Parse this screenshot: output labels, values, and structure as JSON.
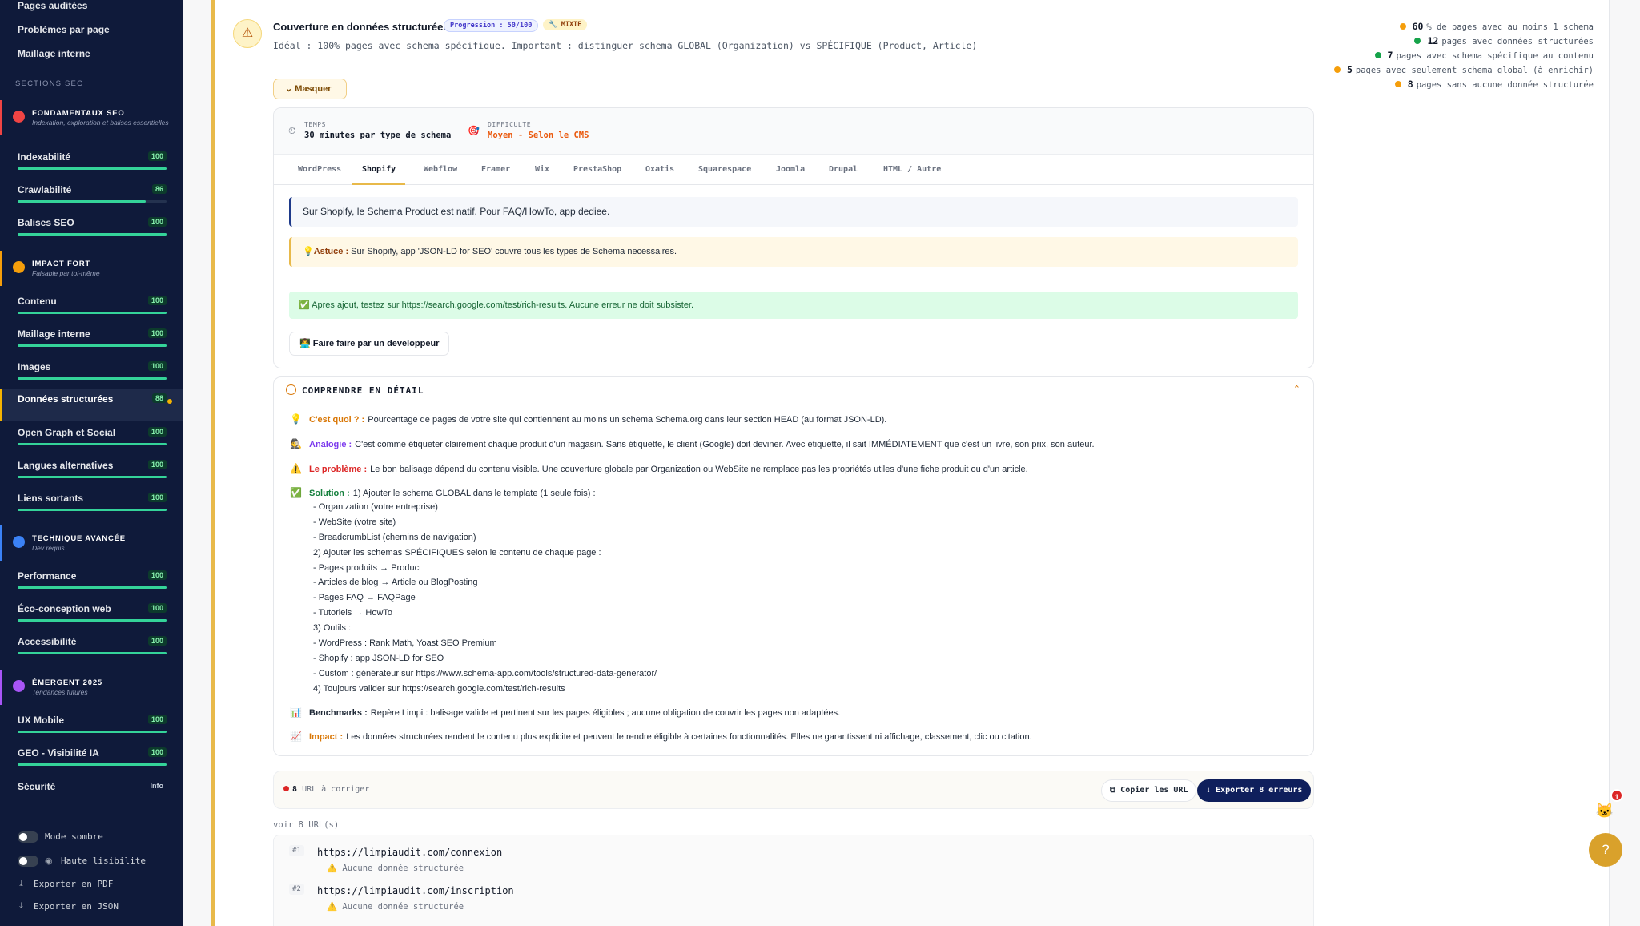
{
  "sidebar": {
    "top_links": [
      "Pages auditées",
      "Problèmes par page",
      "Maillage interne"
    ],
    "section_title": "SECTIONS SEO",
    "categories": [
      {
        "name": "FONDAMENTAUX SEO",
        "sub": "Indexation, exploration et balises essentielles",
        "color": "#ef4444"
      },
      {
        "name": "IMPACT FORT",
        "sub": "Faisable par toi-même",
        "color": "#f59e0b"
      },
      {
        "name": "TECHNIQUE AVANCÉE",
        "sub": "Dev requis",
        "color": "#3b82f6"
      },
      {
        "name": "ÉMERGENT 2025",
        "sub": "Tendances futures",
        "color": "#a855f7"
      }
    ],
    "items": [
      {
        "label": "Indexabilité",
        "score": "100",
        "progress": 100
      },
      {
        "label": "Crawlabilité",
        "score": "86",
        "progress": 86
      },
      {
        "label": "Balises SEO",
        "score": "100",
        "progress": 100
      },
      {
        "label": "Contenu",
        "score": "100",
        "progress": 100
      },
      {
        "label": "Maillage interne",
        "score": "100",
        "progress": 100
      },
      {
        "label": "Images",
        "score": "100",
        "progress": 100
      },
      {
        "label": "Données structurées",
        "score": "88",
        "progress": 88
      },
      {
        "label": "Open Graph et Social",
        "score": "100",
        "progress": 100
      },
      {
        "label": "Langues alternatives",
        "score": "100",
        "progress": 100
      },
      {
        "label": "Liens sortants",
        "score": "100",
        "progress": 100
      },
      {
        "label": "Performance",
        "score": "100",
        "progress": 100
      },
      {
        "label": "Éco-conception web",
        "score": "100",
        "progress": 100
      },
      {
        "label": "Accessibilité",
        "score": "100",
        "progress": 100
      },
      {
        "label": "UX Mobile",
        "score": "100",
        "progress": 100
      },
      {
        "label": "GEO - Visibilité IA",
        "score": "100",
        "progress": 100
      },
      {
        "label": "Sécurité",
        "score": "Info",
        "progress": 0
      }
    ],
    "mode_sombre": "Mode sombre",
    "haute_lisibilite": "Haute lisibilite",
    "export_pdf": "Exporter en PDF",
    "export_json": "Exporter en JSON"
  },
  "card": {
    "title": "Couverture en données structurées",
    "progress_badge": "Progression : 50/100",
    "mixte_badge": "MIXTE",
    "ideal": "Idéal : 100% pages avec schema spécifique. Important : distinguer schema GLOBAL (Organization) vs SPÉCIFIQUE (Product, Article)",
    "stats": [
      {
        "value": "60",
        "text": "% de pages avec au moins 1 schema",
        "color": "#f59e0b"
      },
      {
        "value": "12",
        "text": "pages avec données structurées",
        "color": "#16a34a"
      },
      {
        "value": "7",
        "text": "pages avec schema spécifique au contenu",
        "color": "#16a34a"
      },
      {
        "value": "5",
        "text": "pages avec seulement schema global (à enrichir)",
        "color": "#f59e0b"
      },
      {
        "value": "8",
        "text": "pages sans aucune donnée structurée",
        "color": "#f59e0b"
      }
    ],
    "masquer": "Masquer"
  },
  "guide": {
    "temps_label": "TEMPS",
    "temps_value": "30 minutes par type de schema",
    "difficulte_label": "DIFFICULTE",
    "difficulte_value": "Moyen - Selon le CMS",
    "tabs": [
      "WordPress",
      "Shopify",
      "Webflow",
      "Framer",
      "Wix",
      "PrestaShop",
      "Oxatis",
      "Squarespace",
      "Joomla",
      "Drupal",
      "HTML / Autre"
    ],
    "active_tab": "Shopify",
    "info": "Sur Shopify, le Schema Product est natif. Pour FAQ/HowTo, app dediee.",
    "astuce_label": "Astuce :",
    "astuce_text": "Sur Shopify, app 'JSON-LD for SEO' couvre tous les types de Schema necessaires.",
    "test_text": "Apres ajout, testez sur https://search.google.com/test/rich-results. Aucune erreur ne doit subsister.",
    "dev_button": "Faire faire par un developpeur"
  },
  "details": {
    "title": "COMPRENDRE EN DÉTAIL",
    "cest_quoi_label": "C'est quoi ? :",
    "cest_quoi_text": "Pourcentage de pages de votre site qui contiennent au moins un schema Schema.org dans leur section HEAD (au format JSON-LD).",
    "analogie_label": "Analogie :",
    "analogie_text": "C'est comme étiqueter clairement chaque produit d'un magasin. Sans étiquette, le client (Google) doit deviner. Avec étiquette, il sait IMMÉDIATEMENT que c'est un livre, son prix, son auteur.",
    "probleme_label": "Le problème :",
    "probleme_text": "Le bon balisage dépend du contenu visible. Une couverture globale par Organization ou WebSite ne remplace pas les propriétés utiles d'une fiche produit ou d'un article.",
    "solution_label": "Solution :",
    "solution_lines": [
      "1) Ajouter le schema GLOBAL dans le template (1 seule fois) :",
      "- Organization (votre entreprise)",
      "- WebSite (votre site)",
      "- BreadcrumbList (chemins de navigation)",
      "2) Ajouter les schemas SPÉCIFIQUES selon le contenu de chaque page :",
      "- Pages produits → Product",
      "- Articles de blog → Article ou BlogPosting",
      "- Pages FAQ → FAQPage",
      "- Tutoriels → HowTo",
      "3) Outils :",
      "- WordPress : Rank Math, Yoast SEO Premium",
      "- Shopify : app JSON-LD for SEO",
      "- Custom : générateur sur https://www.schema-app.com/tools/structured-data-generator/",
      "4) Toujours valider sur https://search.google.com/test/rich-results"
    ],
    "benchmarks_label": "Benchmarks :",
    "benchmarks_text": "Repère Limpi : balisage valide et pertinent sur les pages éligibles ; aucune obligation de couvrir les pages non adaptées.",
    "impact_label": "Impact :",
    "impact_text": "Les données structurées rendent le contenu plus explicite et peuvent le rendre éligible à certaines fonctionnalités. Elles ne garantissent ni affichage, classement, clic ou citation."
  },
  "urls": {
    "count": "8",
    "count_label": "URL à corriger",
    "copy_button": "Copier les URL",
    "export_button": "↓ Exporter 8 erreurs",
    "voir": "voir 8 URL(s)",
    "list": [
      {
        "num": "#1",
        "url": "https://limpiaudit.com/connexion",
        "issue": "Aucune donnée structurée"
      },
      {
        "num": "#2",
        "url": "https://limpiaudit.com/inscription",
        "issue": "Aucune donnée structurée"
      }
    ]
  },
  "fab": {
    "badge": "1"
  }
}
